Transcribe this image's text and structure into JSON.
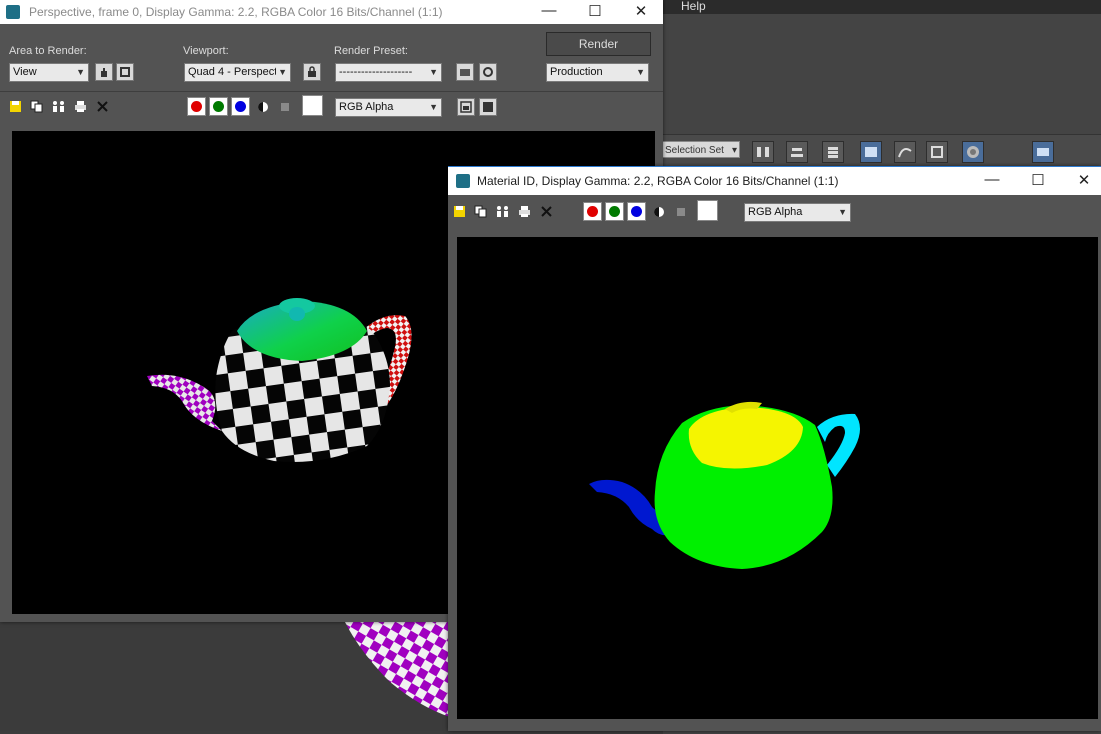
{
  "background": {
    "menu_help": "Help",
    "selection_set": "Selection Set"
  },
  "render_window": {
    "title": "Perspective, frame 0, Display Gamma: 2.2, RGBA Color 16 Bits/Channel (1:1)",
    "area_to_render_label": "Area to Render:",
    "area_to_render_value": "View",
    "viewport_label": "Viewport:",
    "viewport_value": "Quad 4 - Perspect",
    "render_preset_label": "Render Preset:",
    "render_preset_value": "--------------------",
    "render_button": "Render",
    "production_value": "Production",
    "channel_display_value": "RGB Alpha"
  },
  "material_window": {
    "title": "Material ID, Display Gamma: 2.2, RGBA Color 16 Bits/Channel (1:1)",
    "channel_display_value": "RGB Alpha"
  },
  "colors": {
    "red_channel": "#e00000",
    "green_channel": "#007a00",
    "blue_channel": "#0000e0",
    "title_icon": "#1e6f86"
  },
  "icons": [
    "save-icon",
    "copy-icon",
    "clone-icon",
    "print-icon",
    "clear-icon",
    "mono-icon",
    "alpha-icon",
    "hand-icon",
    "crop-icon",
    "lock-icon",
    "preset-icon",
    "settings-icon"
  ]
}
